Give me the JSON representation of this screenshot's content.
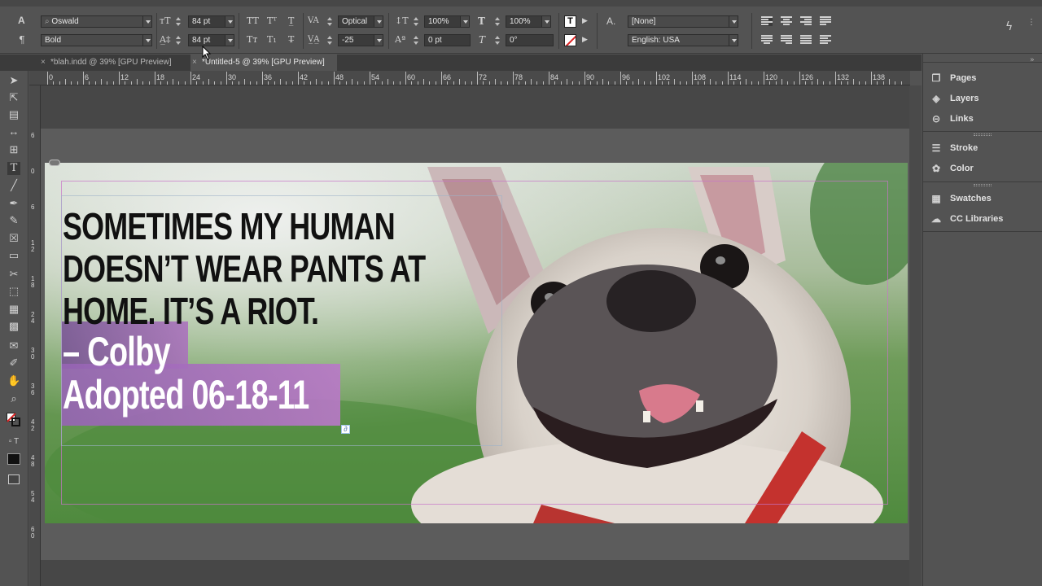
{
  "control_panel": {
    "font_family": "Oswald",
    "font_style": "Bold",
    "font_size": "84 pt",
    "leading": "84 pt",
    "kerning": "Optical",
    "tracking": "-25",
    "vertical_scale": "100%",
    "horizontal_scale": "100%",
    "baseline_shift": "0 pt",
    "skew": "0°",
    "char_style": "[None]",
    "language": "English: USA"
  },
  "tabs": [
    {
      "label": "*blah.indd @ 39% [GPU Preview]",
      "close": "×"
    },
    {
      "label": "*Untitled-5 @ 39% [GPU Preview]",
      "close": "×"
    }
  ],
  "ruler": {
    "h": [
      "0",
      "6",
      "12",
      "18",
      "24",
      "30",
      "36",
      "42",
      "48",
      "54",
      "60",
      "66",
      "72",
      "78",
      "84",
      "90",
      "96",
      "102",
      "108",
      "114",
      "120",
      "126",
      "132",
      "138"
    ],
    "v": [
      "6",
      "0",
      "6",
      "1 2",
      "1 8",
      "2 4",
      "3 0",
      "3 6",
      "4 2",
      "4 8",
      "5 4",
      "6 0"
    ]
  },
  "artwork": {
    "headline": [
      "SOMETIMES MY HUMAN",
      "DOESN’T WEAR PANTS AT",
      "HOME. IT’S A RIOT."
    ],
    "signoff": [
      "– Colby",
      "Adopted 06-18-11"
    ]
  },
  "panels": [
    {
      "label": "Pages",
      "icon": "pages-icon"
    },
    {
      "label": "Layers",
      "icon": "layers-icon"
    },
    {
      "label": "Links",
      "icon": "links-icon"
    },
    {
      "label": "Stroke",
      "icon": "stroke-icon"
    },
    {
      "label": "Color",
      "icon": "color-icon"
    },
    {
      "label": "Swatches",
      "icon": "swatches-icon"
    },
    {
      "label": "CC Libraries",
      "icon": "cc-libraries-icon"
    }
  ]
}
